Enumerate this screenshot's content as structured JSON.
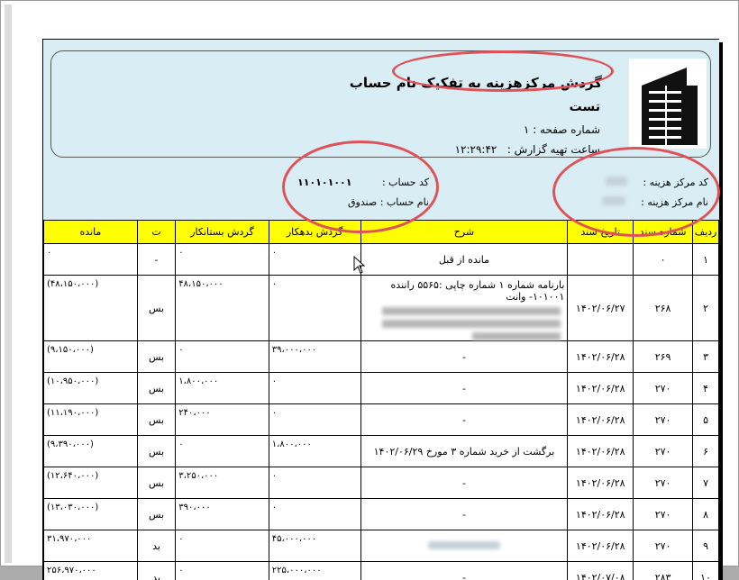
{
  "report": {
    "title": "گردش مرکزهزینه به تفکیک نام حساب",
    "company": "تست",
    "page_label": "شماره صفحه : ۱",
    "time_label": "ساعت تهیه گزارش :",
    "time_value": "۱۲:۲۹:۴۲",
    "cost_center_code_label": "کد مرکز هزینه :",
    "cost_center_name_label": "نام مرکز هزینه :",
    "account_code_label": "کد حساب :",
    "account_code_value": "۱۱۰۱۰۱۰۰۱",
    "account_name_label": "نام حساب :",
    "account_name_value": "صندوق"
  },
  "table": {
    "headers": [
      "ردیف",
      "شماره سند",
      "تاریخ سند",
      "شرح",
      "گردش بدهکار",
      "گردش بستانکار",
      "ت",
      "مانده"
    ],
    "rows": [
      {
        "row": "۱",
        "doc": "۰",
        "date": "",
        "desc": "مانده از قبل",
        "debit": "۰",
        "credit": "۰",
        "t": "-",
        "balance": "۰"
      },
      {
        "row": "۲",
        "doc": "۲۶۸",
        "date": "۱۴۰۲/۰۶/۲۷",
        "desc": "بارنامه شماره ۱ شماره چاپی :۵۵۶۵ راننده ۱۰۱۰۰۱- وانت",
        "debit": "۰",
        "credit": "۴۸،۱۵۰،۰۰۰",
        "t": "بس",
        "balance": "(۴۸،۱۵۰،۰۰۰)"
      },
      {
        "row": "۳",
        "doc": "۲۶۹",
        "date": "۱۴۰۲/۰۶/۲۸",
        "desc": "-",
        "debit": "۳۹،۰۰۰،۰۰۰",
        "credit": "۰",
        "t": "بس",
        "balance": "(۹،۱۵۰،۰۰۰)"
      },
      {
        "row": "۴",
        "doc": "۲۷۰",
        "date": "۱۴۰۲/۰۶/۲۸",
        "desc": "-",
        "debit": "۰",
        "credit": "۱،۸۰۰،۰۰۰",
        "t": "بس",
        "balance": "(۱۰،۹۵۰،۰۰۰)"
      },
      {
        "row": "۵",
        "doc": "۲۷۰",
        "date": "۱۴۰۲/۰۶/۲۸",
        "desc": "-",
        "debit": "۰",
        "credit": "۲۴۰،۰۰۰",
        "t": "بس",
        "balance": "(۱۱،۱۹۰،۰۰۰)"
      },
      {
        "row": "۶",
        "doc": "۲۷۰",
        "date": "۱۴۰۲/۰۶/۲۸",
        "desc": "برگشت از خرید شماره ۳ مورخ ۱۴۰۲/۰۶/۲۹",
        "debit": "۱،۸۰۰،۰۰۰",
        "credit": "۰",
        "t": "بس",
        "balance": "(۹،۳۹۰،۰۰۰)"
      },
      {
        "row": "۷",
        "doc": "۲۷۰",
        "date": "۱۴۰۲/۰۶/۲۸",
        "desc": "-",
        "debit": "۰",
        "credit": "۳،۲۵۰،۰۰۰",
        "t": "بس",
        "balance": "(۱۲،۶۴۰،۰۰۰)"
      },
      {
        "row": "۸",
        "doc": "۲۷۰",
        "date": "۱۴۰۲/۰۶/۲۸",
        "desc": "-",
        "debit": "۰",
        "credit": "۳۹۰،۰۰۰",
        "t": "بس",
        "balance": "(۱۳،۰۳۰،۰۰۰)"
      },
      {
        "row": "۹",
        "doc": "۲۷۰",
        "date": "۱۴۰۲/۰۶/۲۸",
        "desc": "",
        "debit": "۴۵،۰۰۰،۰۰۰",
        "credit": "۰",
        "t": "بد",
        "balance": "۳۱،۹۷۰،۰۰۰"
      },
      {
        "row": "۱۰",
        "doc": "۲۸۳",
        "date": "۱۴۰۲/۰۷/۰۸",
        "desc": "-",
        "debit": "۲۲۵،۰۰۰،۰۰۰",
        "credit": "۰",
        "t": "بد",
        "balance": "۲۵۶،۹۷۰،۰۰۰"
      }
    ]
  }
}
